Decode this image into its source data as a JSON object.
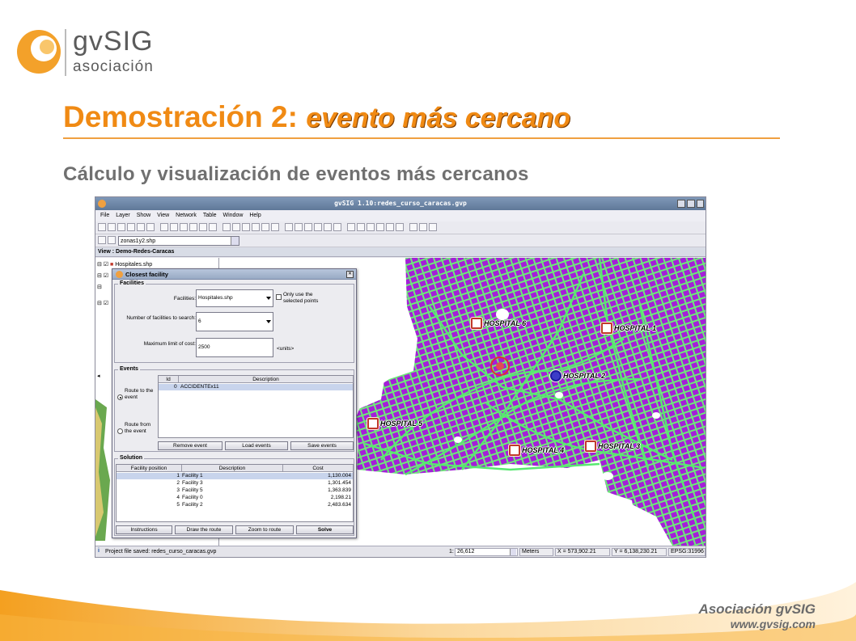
{
  "slide": {
    "logo_text": "gvSIG",
    "logo_sub": "asociación",
    "title_main": "Demostración 2: ",
    "title_em": "evento más cercano",
    "subtitle": "Cálculo y visualización de eventos más cercanos",
    "footer_org": "Asociación gvSIG",
    "footer_web": "www.gvsig.com",
    "accent_color": "#f08a14"
  },
  "app": {
    "window_title": "gvSIG 1.10:redes_curso_caracas.gvp",
    "menu": [
      "File",
      "Layer",
      "Show",
      "View",
      "Network",
      "Table",
      "Window",
      "Help"
    ],
    "layer_select": "zonas1y2.shp",
    "view_title": "View : Demo-Redes-Caracas",
    "toc_layer": "Hospitales.shp",
    "map": {
      "hospitals": [
        {
          "label": "HOSPITAL 6",
          "selected": false
        },
        {
          "label": "HOSPITAL 1",
          "selected": false
        },
        {
          "label": "HOSPITAL 2",
          "selected": true
        },
        {
          "label": "HOSPITAL 5",
          "selected": false
        },
        {
          "label": "HOSPITAL 4",
          "selected": false
        },
        {
          "label": "HOSPITAL 3",
          "selected": false
        }
      ],
      "land_color": "#a41fd8",
      "road_color": "#6ee87a",
      "route_color": "#58e870"
    },
    "dialog": {
      "title": "Closest facility",
      "facilities_group": "Facilities",
      "facilities_label": "Facilities:",
      "facilities_value": "Hospitales.shp",
      "only_selected_label": "Only use the selected points",
      "num_label": "Number of facilities to search:",
      "num_value": "6",
      "max_label": "Maximum limit of cost:",
      "max_value": "2500",
      "units": "<units>",
      "events_group": "Events",
      "route_to": "Route to the event",
      "route_from": "Route from the event",
      "events_columns": [
        "Id",
        "Description"
      ],
      "events_rows": [
        {
          "id": "0",
          "description": "ACCIDENTEx11"
        }
      ],
      "remove_event": "Remove event",
      "load_events": "Load events",
      "save_events": "Save events",
      "solution_group": "Solution",
      "solution_columns": [
        "Facility position",
        "Description",
        "Cost"
      ],
      "solution_rows": [
        {
          "pos": "1",
          "desc": "Facility 1",
          "cost": "1,130.004"
        },
        {
          "pos": "2",
          "desc": "Facility 3",
          "cost": "1,301.454"
        },
        {
          "pos": "3",
          "desc": "Facility 5",
          "cost": "1,363.839"
        },
        {
          "pos": "4",
          "desc": "Facility 0",
          "cost": "2,198.21"
        },
        {
          "pos": "5",
          "desc": "Facility 2",
          "cost": "2,483.634"
        }
      ],
      "instructions": "Instructions",
      "draw_route": "Draw the route",
      "zoom_route": "Zoom to route",
      "solve": "Solve"
    },
    "status": {
      "message": "Project file saved: redes_curso_caracas.gvp",
      "scale_prefix": "1:",
      "scale": "26,612",
      "units": "Meters",
      "x": "X = 573,902.21",
      "y": "Y = 6,138,230.21",
      "epsg": "EPSG:31996"
    }
  }
}
